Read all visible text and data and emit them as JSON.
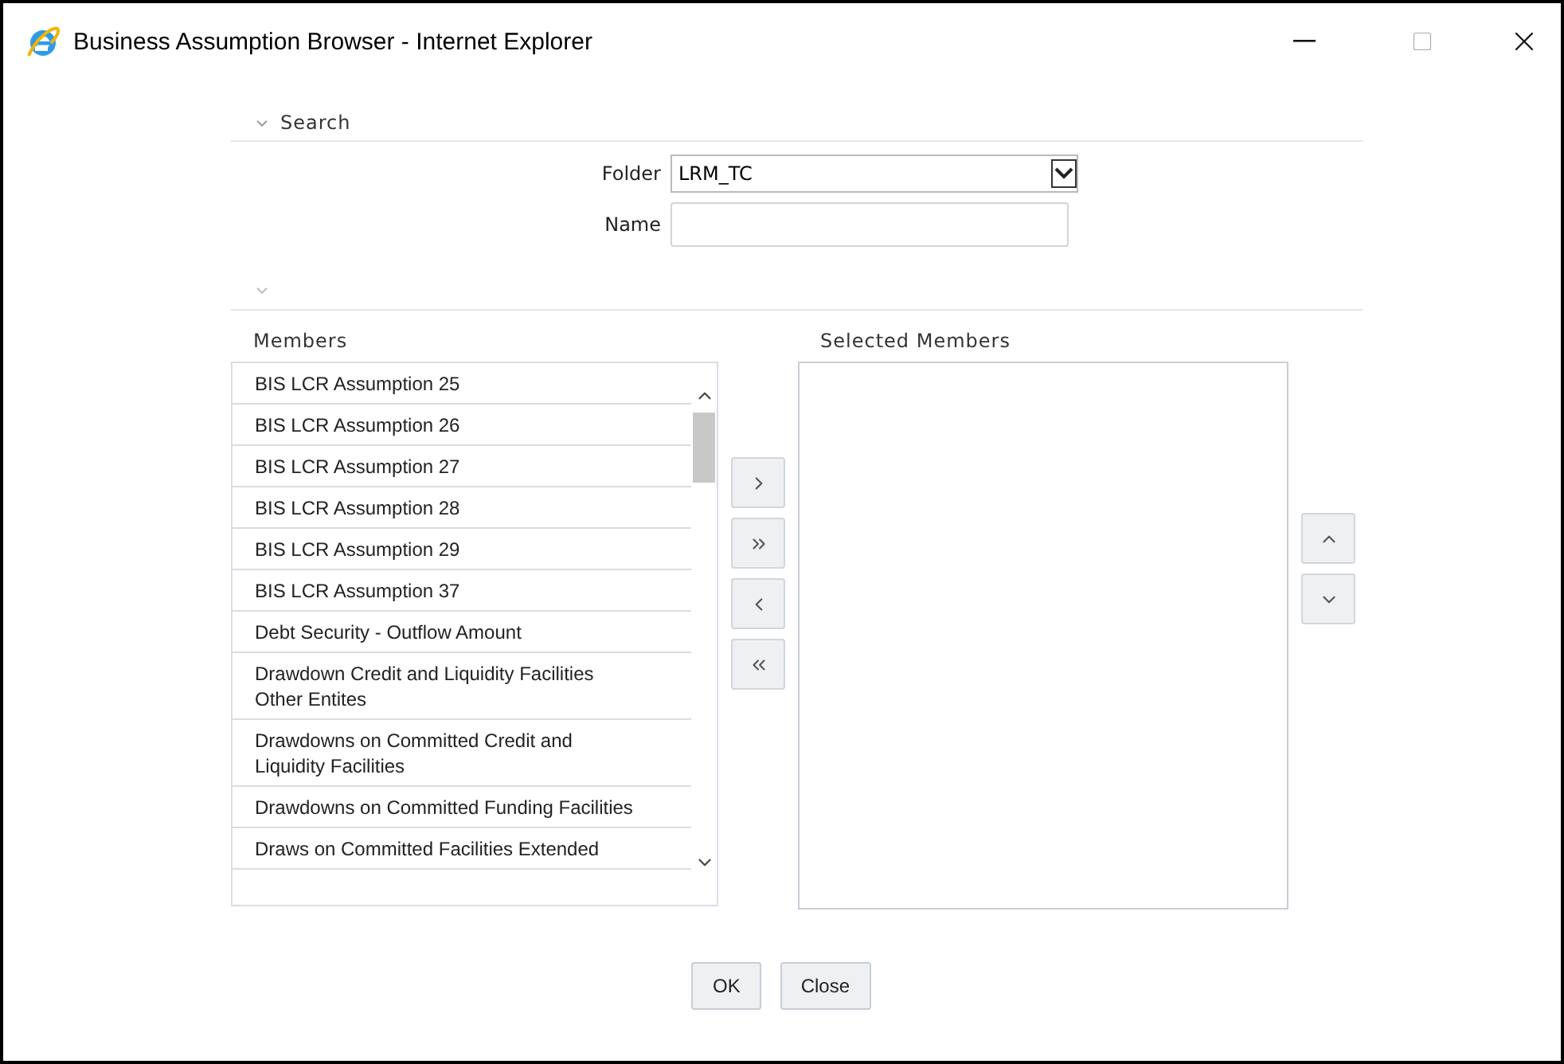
{
  "window": {
    "title": "Business Assumption Browser - Internet Explorer"
  },
  "search": {
    "heading": "Search",
    "expanded": true,
    "folder": {
      "label": "Folder",
      "value": "LRM_TC"
    },
    "name": {
      "label": "Name"
    }
  },
  "members": {
    "heading": "Members",
    "items": [
      {
        "label": "BIS LCR Assumption 25",
        "selected": false
      },
      {
        "label": "BIS LCR Assumption 26",
        "selected": false
      },
      {
        "label": "BIS LCR Assumption 27",
        "selected": false
      },
      {
        "label": "BIS LCR Assumption 28",
        "selected": false
      },
      {
        "label": "BIS LCR Assumption 29",
        "selected": false
      },
      {
        "label": "BIS LCR Assumption 37",
        "selected": false
      },
      {
        "label": "Debt Security - Outflow Amount",
        "selected": false
      },
      {
        "label": "Drawdown Credit and Liquidity Facilities Other Entites",
        "selected": false
      },
      {
        "label": "Drawdowns on Committed Credit and Liquidity Facilities",
        "selected": false
      },
      {
        "label": "Drawdowns on Committed Funding Facilities",
        "selected": false
      },
      {
        "label": "Draws on Committed Facilities Extended",
        "selected": false
      }
    ]
  },
  "selected_members": {
    "heading": "Selected Members"
  },
  "buttons": [
    "OK",
    "Close"
  ]
}
